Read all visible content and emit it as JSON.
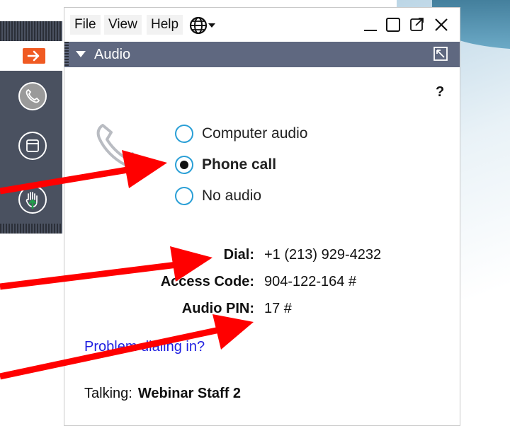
{
  "menu": {
    "file": "File",
    "view": "View",
    "help": "Help"
  },
  "panel": {
    "title": "Audio",
    "help_label": "?"
  },
  "audio_options": [
    {
      "label": "Computer audio",
      "selected": false
    },
    {
      "label": "Phone call",
      "selected": true
    },
    {
      "label": "No audio",
      "selected": false
    }
  ],
  "dial_info": {
    "dial_label": "Dial:",
    "dial_value": "+1 (213) 929-4232",
    "access_label": "Access Code:",
    "access_value": "904-122-164 #",
    "pin_label": "Audio PIN:",
    "pin_value": "17 #"
  },
  "problem_link": "Problem dialing in?",
  "talking": {
    "label": "Talking:",
    "name": "Webinar Staff 2"
  },
  "icons": {
    "globe": "globe-icon",
    "minimize": "minimize-icon",
    "maximize": "maximize-icon",
    "popout": "popout-icon",
    "close": "close-icon",
    "phone": "phone-icon",
    "hand": "raise-hand-icon",
    "arrow": "arrow-right-icon"
  },
  "colors": {
    "header": "#5f6880",
    "radio_border": "#2a9fd6",
    "link": "#1f1fe0",
    "arrow_button": "#f05a22",
    "annotation_arrow": "#ff0000"
  }
}
